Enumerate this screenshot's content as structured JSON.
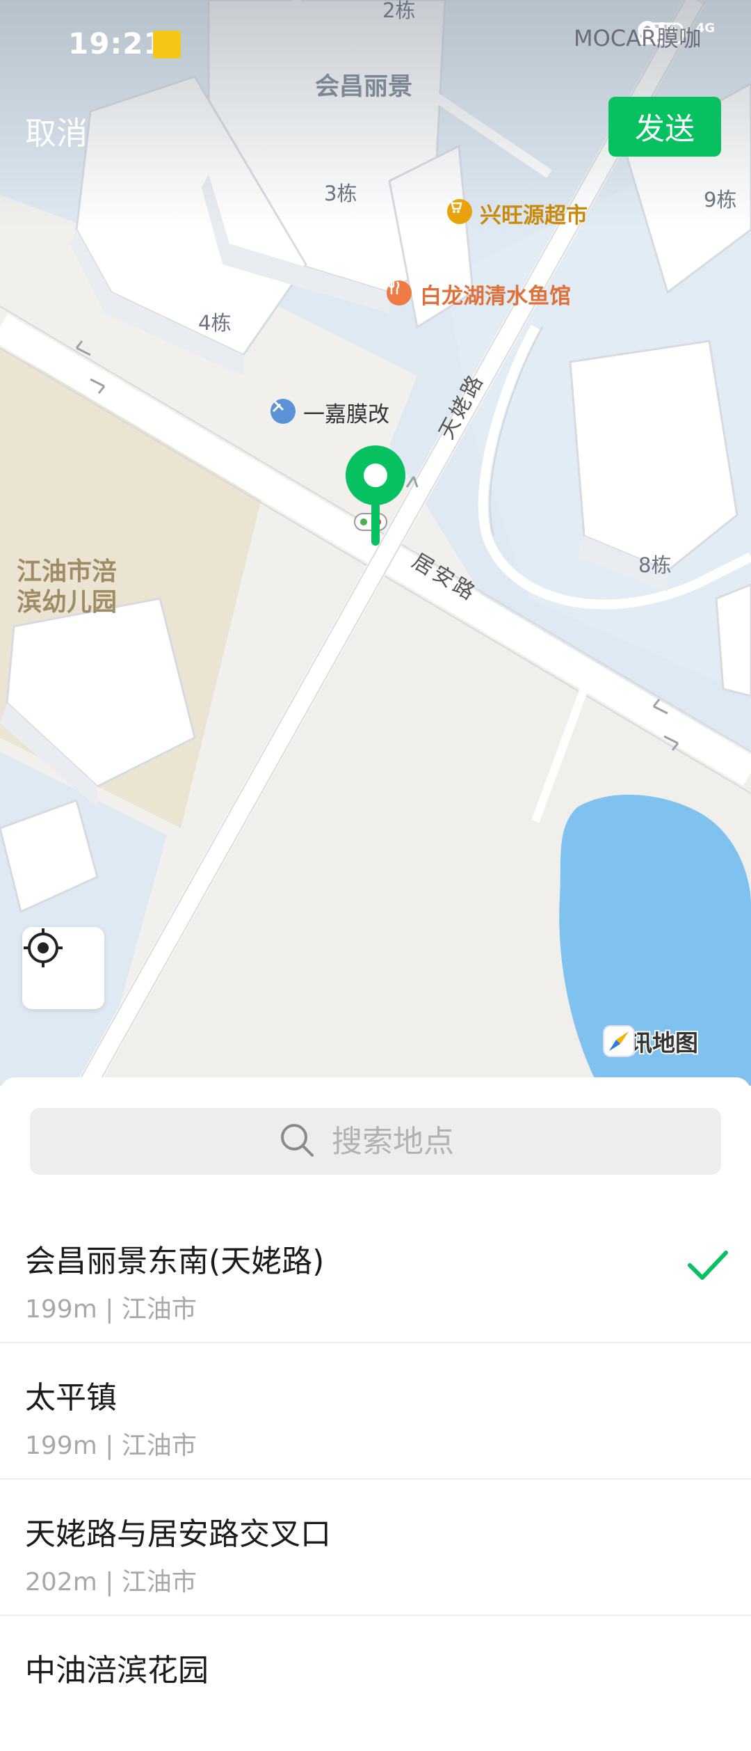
{
  "status_bar": {
    "time": "19:21",
    "network_5g": "5G",
    "network_4g": "4G",
    "carrier": "MOCAR膜咖"
  },
  "header": {
    "cancel_label": "取消",
    "send_label": "发送"
  },
  "map": {
    "building_labels": {
      "top_complex": "会昌丽景",
      "b2": "2栋",
      "b3": "3栋",
      "b4": "4栋",
      "b8": "8栋",
      "b9": "9栋",
      "kindergarten": "江油市涪\n滨幼儿园"
    },
    "road_labels": {
      "tianlao": "天姥路",
      "juan": "居安路"
    },
    "pois": [
      {
        "name": "兴旺源超市",
        "icon": "shopping-cart-icon",
        "color": "#c98a0b"
      },
      {
        "name": "白龙湖清水鱼馆",
        "icon": "fork-knife-icon",
        "color": "#e0703a"
      },
      {
        "name": "一嘉膜改",
        "icon": "wrench-icon",
        "color": "#4a90d9"
      }
    ],
    "logo_text": "腾讯地图",
    "colors": {
      "water": "#a8d3f5",
      "lake": "#7fc2f0",
      "ground": "#f1f0ed",
      "building_blue": "#dfe9f3",
      "kindergarten_area": "#ebe4d3",
      "pin": "#07c160"
    }
  },
  "search": {
    "placeholder": "搜索地点"
  },
  "places": [
    {
      "name": "会昌丽景东南(天姥路)",
      "sub": "199m | 江油市",
      "selected": true
    },
    {
      "name": "太平镇",
      "sub": "199m | 江油市",
      "selected": false
    },
    {
      "name": "天姥路与居安路交叉口",
      "sub": "202m | 江油市",
      "selected": false
    },
    {
      "name": "中油涪滨花园",
      "sub": "",
      "selected": false
    }
  ],
  "accent_color": "#07c160"
}
